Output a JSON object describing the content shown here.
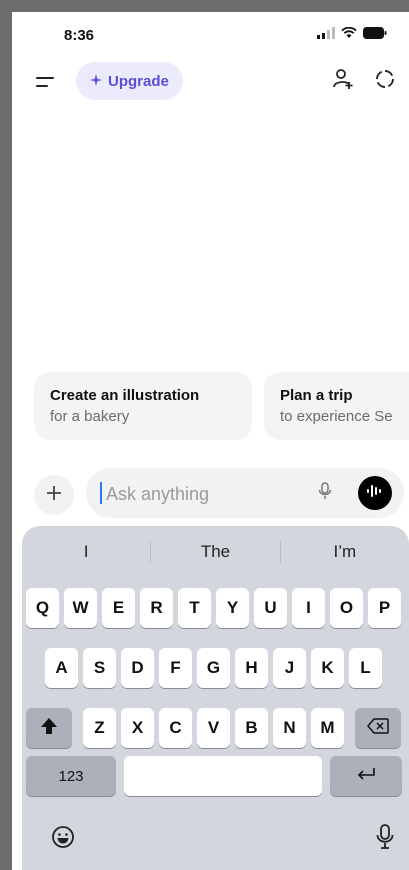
{
  "status": {
    "time": "8:36"
  },
  "header": {
    "upgrade_label": "Upgrade"
  },
  "suggestions": [
    {
      "title": "Create an illustration",
      "subtitle": "for a bakery"
    },
    {
      "title": "Plan a trip",
      "subtitle": "to experience Se"
    }
  ],
  "composer": {
    "placeholder": "Ask anything",
    "value": ""
  },
  "keyboard": {
    "predictions": [
      "I",
      "The",
      "I’m"
    ],
    "row1": [
      "Q",
      "W",
      "E",
      "R",
      "T",
      "Y",
      "U",
      "I",
      "O",
      "P"
    ],
    "row2": [
      "A",
      "S",
      "D",
      "F",
      "G",
      "H",
      "J",
      "K",
      "L"
    ],
    "row3": [
      "Z",
      "X",
      "C",
      "V",
      "B",
      "N",
      "M"
    ],
    "numbers_label": "123"
  },
  "colors": {
    "accent": "#5b4fd6",
    "upgrade_bg": "#ecebfb",
    "keyboard_bg": "#d3d6dd"
  }
}
